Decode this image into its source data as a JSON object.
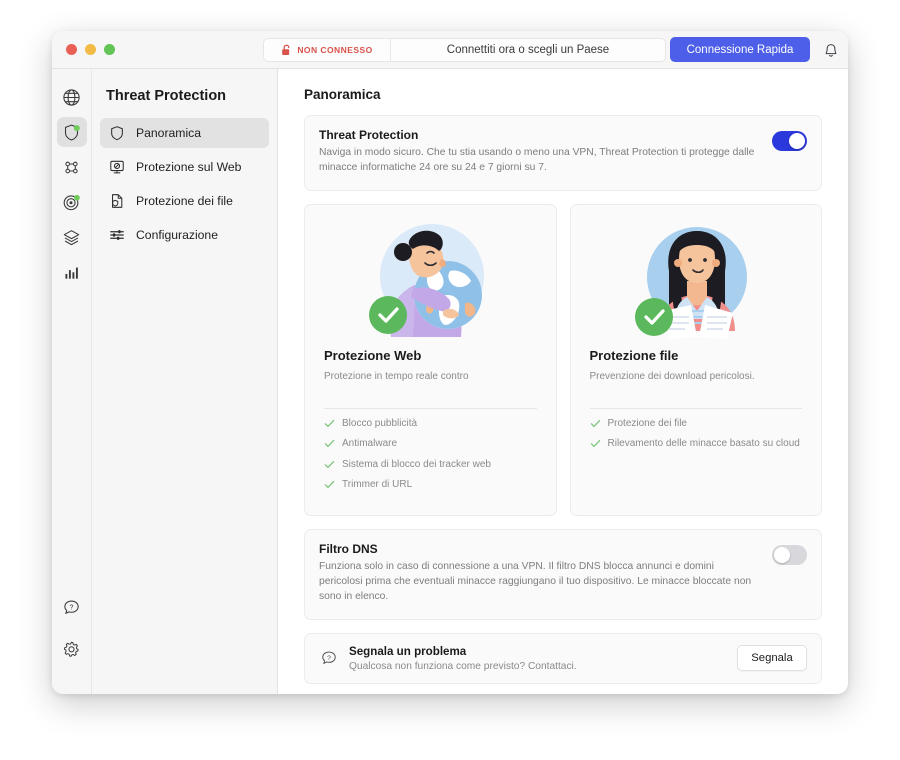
{
  "titlebar": {
    "connection_status": "NON CONNESSO",
    "connection_hint": "Connettiti ora o scegli un Paese",
    "quick_connect_label": "Connessione Rapida",
    "status_color": "#d8524a",
    "accent_color": "#4d5fe8",
    "icons": {
      "lock": "unlocked-padlock-icon",
      "bell": "bell-icon"
    }
  },
  "rail": {
    "items": [
      {
        "name": "globe",
        "label": "globe-icon",
        "active": false,
        "badge": false
      },
      {
        "name": "shield",
        "label": "shield-icon",
        "active": true,
        "badge": true
      },
      {
        "name": "mesh",
        "label": "mesh-nodes-icon",
        "active": false,
        "badge": false
      },
      {
        "name": "radar",
        "label": "radar-icon",
        "active": false,
        "badge": true
      },
      {
        "name": "layers",
        "label": "layers-icon",
        "active": false,
        "badge": false
      },
      {
        "name": "stats",
        "label": "bar-chart-icon",
        "active": false,
        "badge": false
      }
    ],
    "bottom": [
      {
        "name": "help",
        "label": "help-bubble-icon"
      },
      {
        "name": "settings",
        "label": "gear-icon"
      }
    ]
  },
  "sidebar": {
    "title": "Threat Protection",
    "items": [
      {
        "label": "Panoramica",
        "icon": "shield-icon",
        "active": true
      },
      {
        "label": "Protezione sul Web",
        "icon": "monitor-block-icon",
        "active": false
      },
      {
        "label": "Protezione dei file",
        "icon": "file-shield-icon",
        "active": false
      },
      {
        "label": "Configurazione",
        "icon": "sliders-icon",
        "active": false
      }
    ]
  },
  "main": {
    "page_title": "Panoramica",
    "threat_protection": {
      "title": "Threat Protection",
      "description": "Naviga in modo sicuro. Che tu stia usando o meno una VPN, Threat Protection ti protegge dalle minacce informatiche 24 ore su 24 e 7 giorni su 7.",
      "toggle_on": true
    },
    "cards": [
      {
        "title": "Protezione Web",
        "subtitle": "Protezione in tempo reale contro",
        "illustration": "woman-hugging-globe-illustration",
        "badge": "green-check-badge",
        "features": [
          "Blocco pubblicità",
          "Antimalware",
          "Sistema di blocco dei tracker web",
          "Trimmer di URL"
        ]
      },
      {
        "title": "Protezione file",
        "subtitle": "Prevenzione dei download pericolosi.",
        "illustration": "woman-holding-documents-illustration",
        "badge": "green-check-badge",
        "features": [
          "Protezione dei file",
          "Rilevamento delle minacce basato su cloud"
        ]
      }
    ],
    "dns_filter": {
      "title": "Filtro DNS",
      "description": "Funziona solo in caso di connessione a una VPN. Il filtro DNS blocca annunci e domini pericolosi prima che eventuali minacce raggiungano il tuo dispositivo. Le minacce bloccate non sono in elenco.",
      "toggle_on": false
    },
    "report_issue": {
      "title": "Segnala un problema",
      "subtitle": "Qualcosa non funziona come previsto? Contattaci.",
      "button_label": "Segnala",
      "icon": "help-bubble-icon"
    }
  },
  "colors": {
    "toggle_on": "#2b38db",
    "toggle_off": "#d8d8dc",
    "check_green": "#5cb85c",
    "feature_check": "#7ac47a"
  }
}
